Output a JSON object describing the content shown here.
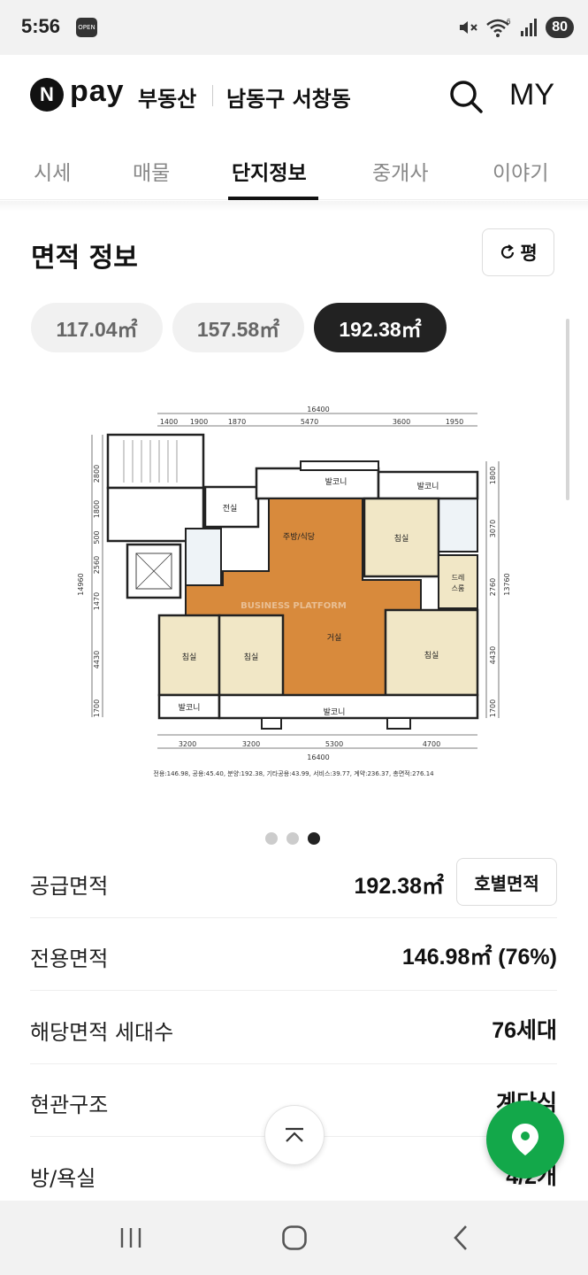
{
  "status_bar": {
    "time": "5:56",
    "app_badge": "OPEN",
    "battery": "80",
    "wifi_label": "6"
  },
  "header": {
    "logo_n": "N",
    "logo_pay": "pay",
    "service": "부동산",
    "title": "남동구 서창동",
    "my_label": "MY"
  },
  "tabs": [
    {
      "label": "시세",
      "active": false
    },
    {
      "label": "매물",
      "active": false
    },
    {
      "label": "단지정보",
      "active": true
    },
    {
      "label": "중개사",
      "active": false
    },
    {
      "label": "이야기",
      "active": false
    }
  ],
  "area_section": {
    "title": "면적 정보",
    "unit_toggle": "평",
    "chips": [
      {
        "label": "117.04㎡",
        "selected": false
      },
      {
        "label": "157.58㎡",
        "selected": false
      },
      {
        "label": "192.38㎡",
        "selected": true
      }
    ]
  },
  "floorplan": {
    "top_total": "16400",
    "top_dims": [
      "1400",
      "1900",
      "1870",
      "5470",
      "3600",
      "1950"
    ],
    "bottom_dims": [
      "3200",
      "3200",
      "5300",
      "4700"
    ],
    "bottom_total": "16400",
    "left_dims": [
      "2800",
      "1800",
      "500",
      "2560",
      "1470",
      "4430",
      "1700"
    ],
    "left_total": "14960",
    "right_dims": [
      "1800",
      "3070",
      "2760",
      "4430",
      "1700"
    ],
    "right_total": "13760",
    "rooms": {
      "balcony_1": "발코니",
      "balcony_2": "발코니",
      "balcony_3": "발코니",
      "balcony_4": "발코니",
      "front_room": "전실",
      "kitchen": "주방/식당",
      "bedroom_1": "침실",
      "bedroom_2": "침실",
      "bedroom_3": "침실",
      "bedroom_4": "침실",
      "living": "거실",
      "dress_1": "드레",
      "dress_2": "스룸"
    },
    "watermark": "BUSINESS PLATFORM",
    "caption": "전용:146.98, 공용:45.40, 분양:192.38, 기타공용:43.99, 서비스:39.77, 계약:236.37, 총면적:276.14"
  },
  "carousel": {
    "count": 3,
    "active_index": 2
  },
  "info_rows": [
    {
      "label": "공급면적",
      "value": "192.38㎡",
      "button": "호별면적"
    },
    {
      "label": "전용면적",
      "value": "146.98㎡ (76%)"
    },
    {
      "label": "해당면적 세대수",
      "value": "76세대"
    },
    {
      "label": "현관구조",
      "value": "계단식"
    },
    {
      "label": "방/욕실",
      "value": "4/2개"
    }
  ],
  "colors": {
    "fab_green": "#13a84a",
    "floor_wood": "#d88a3c",
    "room_beige": "#f1e7c6",
    "selected_chip": "#222222"
  }
}
